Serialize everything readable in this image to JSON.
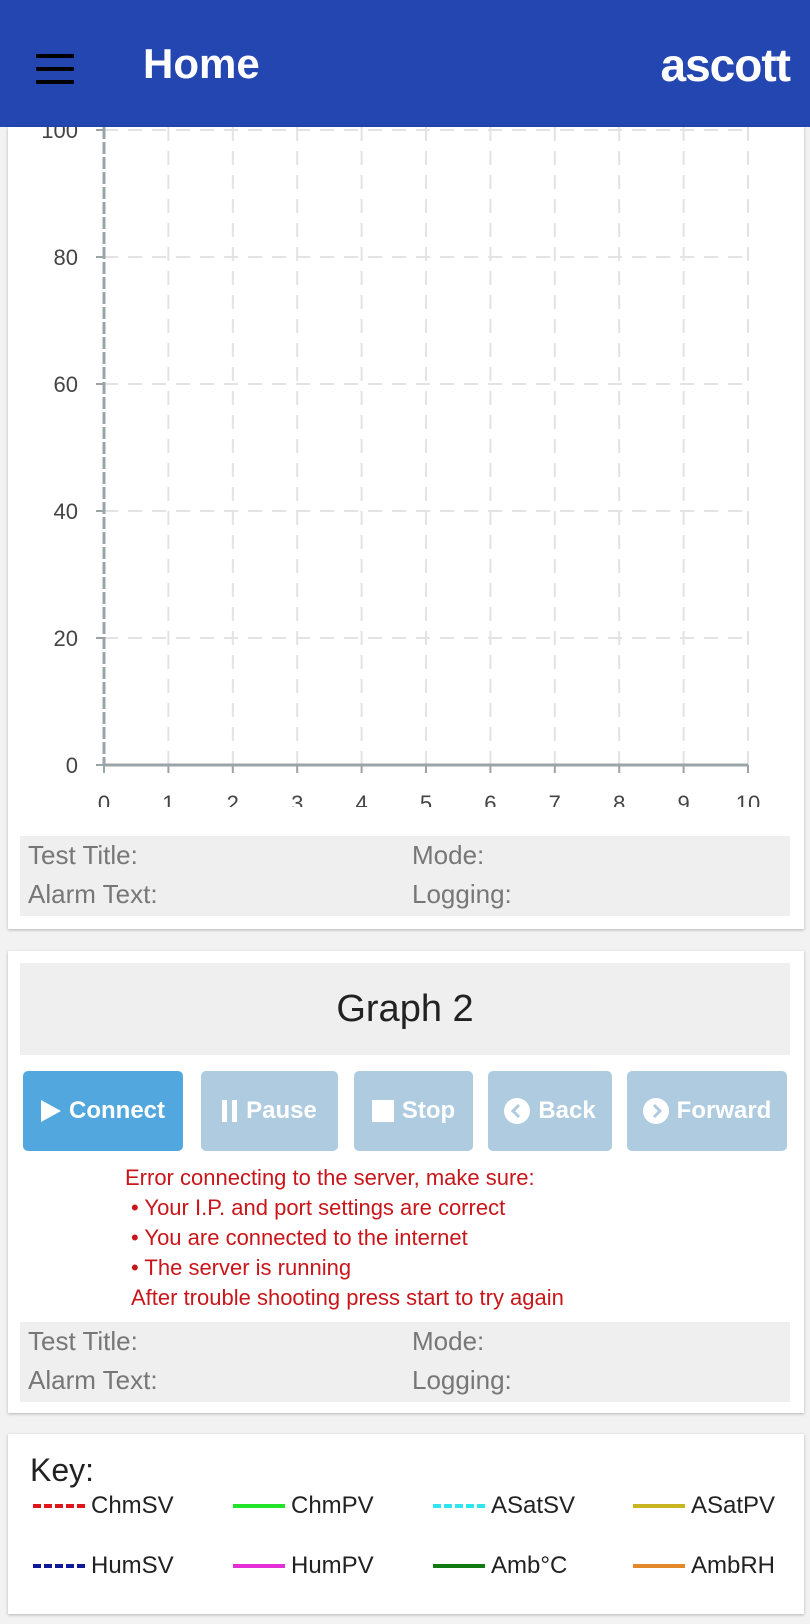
{
  "header": {
    "title": "Home",
    "brand": "ascott",
    "menu_icon": "hamburger-menu-icon",
    "color": "#2446b0"
  },
  "graph1": {
    "chart_data": {
      "type": "line",
      "x_ticks": [
        0,
        1,
        2,
        3,
        4,
        5,
        6,
        7,
        8,
        9,
        10
      ],
      "y_ticks": [
        0,
        20,
        40,
        60,
        80,
        100
      ],
      "xlim": [
        0,
        10
      ],
      "ylim": [
        0,
        100
      ],
      "grid": true,
      "series": []
    },
    "info": {
      "test_title_label": "Test Title:",
      "mode_label": "Mode:",
      "alarm_text_label": "Alarm Text:",
      "logging_label": "Logging:"
    }
  },
  "graph2": {
    "title": "Graph 2",
    "buttons": {
      "connect": "Connect",
      "pause": "Pause",
      "stop": "Stop",
      "back": "Back",
      "forward": "Forward"
    },
    "error": {
      "line1": "Error connecting to the server, make sure:",
      "bullet1": "• Your I.P. and port settings are correct",
      "bullet2": "• You are connected to the internet",
      "bullet3": "• The server is running",
      "line_last": "After trouble shooting press start to try again"
    },
    "info": {
      "test_title_label": "Test Title:",
      "mode_label": "Mode:",
      "alarm_text_label": "Alarm Text:",
      "logging_label": "Logging:"
    }
  },
  "key": {
    "title": "Key:",
    "items": [
      {
        "label": "ChmSV",
        "color": "#e0151b",
        "dashed": true
      },
      {
        "label": "ChmPV",
        "color": "#22e22a",
        "dashed": false
      },
      {
        "label": "ASatSV",
        "color": "#2ee6ee",
        "dashed": true
      },
      {
        "label": "ASatPV",
        "color": "#c8b621",
        "dashed": false
      },
      {
        "label": "HumSV",
        "color": "#0c1a9a",
        "dashed": true
      },
      {
        "label": "HumPV",
        "color": "#e52fd6",
        "dashed": false
      },
      {
        "label": "Amb°C",
        "color": "#127a12",
        "dashed": false
      },
      {
        "label": "AmbRH",
        "color": "#e3892a",
        "dashed": false
      }
    ]
  }
}
